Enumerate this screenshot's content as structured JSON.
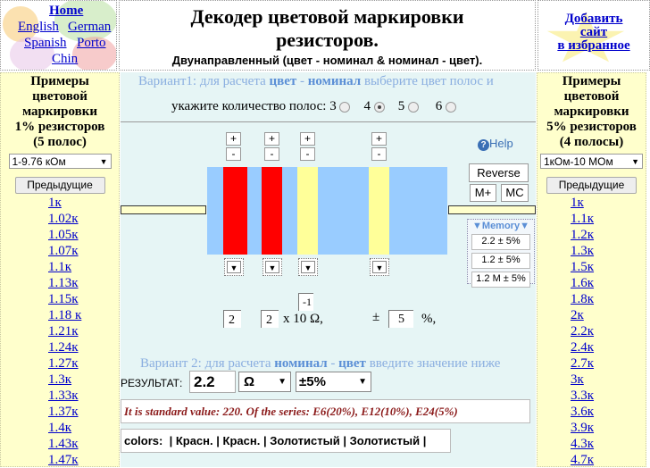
{
  "nav": {
    "home": "Home",
    "english": "English",
    "german": "German",
    "spanish": "Spanish",
    "porto": "Porto",
    "chin": "Chin"
  },
  "header": {
    "title_line1": "Декодер цветовой маркировки",
    "title_line2": "резисторов.",
    "subtitle": "Двунаправленный (цвет - номинал & номинал - цвет)."
  },
  "favorites": {
    "line1": "Добавить",
    "line2": "сайт",
    "line3": "в избранное"
  },
  "left_panel": {
    "title_lines": [
      "Примеры",
      "цветовой",
      "маркировки",
      "1% резисторов",
      "(5 полос)"
    ],
    "range_select": "1-9.76 кОм",
    "prev_button": "Предыдущие",
    "items": [
      "1к",
      "1.02к",
      "1.05к",
      "1.07к",
      "1.1к",
      "1.13к",
      "1.15к",
      "1.18 к",
      "1.21к",
      "1.24к",
      "1.27к",
      "1.3к",
      "1.33к",
      "1.37к",
      "1.4к",
      "1.43к",
      "1.47к"
    ]
  },
  "right_panel": {
    "title_lines": [
      "Примеры",
      "цветовой",
      "маркировки",
      "5% резисторов",
      "(4 полосы)"
    ],
    "range_select": "1кОм-10 МОм",
    "prev_button": "Предыдущие",
    "items": [
      "1к",
      "1.1к",
      "1.2к",
      "1.3к",
      "1.5к",
      "1.6к",
      "1.8к",
      "2к",
      "2.2к",
      "2.4к",
      "2.7к",
      "3к",
      "3.3к",
      "3.6к",
      "3.9к",
      "4.3к",
      "4.7к"
    ]
  },
  "variant1": {
    "text_a": "Вариант1: для расчета ",
    "text_b": "цвет",
    "text_c": " - ",
    "text_d": "номинал",
    "text_e": " выберите цвет полос и",
    "band_count_label": "укажите количество полос: 3",
    "opt4": "4",
    "opt5": "5",
    "opt6": "6",
    "selected": "4"
  },
  "resistor": {
    "bands": [
      {
        "color": "#ff0000",
        "name": "Красн."
      },
      {
        "color": "#ff0000",
        "name": "Красн."
      },
      {
        "color": "#ffff99",
        "name": "Золотистый"
      },
      {
        "color": "#ffff99",
        "name": "Золотистый"
      }
    ],
    "body_color": "#99ccff",
    "plus": "+",
    "minus": "-",
    "dropdown_arrow": "▼"
  },
  "controls": {
    "help": "Help",
    "reverse": "Reverse",
    "mplus": "M+",
    "mc": "MC",
    "memory_title": "▼Memory▼",
    "memory_items": [
      "2.2 ± 5%",
      "1.2 ± 5%",
      "1.2 M ± 5%"
    ]
  },
  "formula": {
    "digit1": "2",
    "digit2": "2",
    "times": "x 10",
    "exponent": "-1",
    "ohm": "Ω,",
    "pm": "±",
    "tolerance": "5",
    "percent": "%,"
  },
  "variant2": {
    "text_a": "Вариант 2: для расчета ",
    "text_b": "номинал",
    "text_c": " - ",
    "text_d": "цвет",
    "text_e": " введите значение ниже"
  },
  "result": {
    "label": "РЕЗУЛЬТАТ:",
    "value": "2.2",
    "unit": "Ω",
    "tolerance": "±5%",
    "message": "It is standard value: 220. Of the series:  E6(20%), E12(10%), E24(5%)",
    "colors_label": "colors:",
    "colors": [
      "Красн.",
      "Красн.",
      "Золотистый",
      "Золотистый"
    ]
  }
}
